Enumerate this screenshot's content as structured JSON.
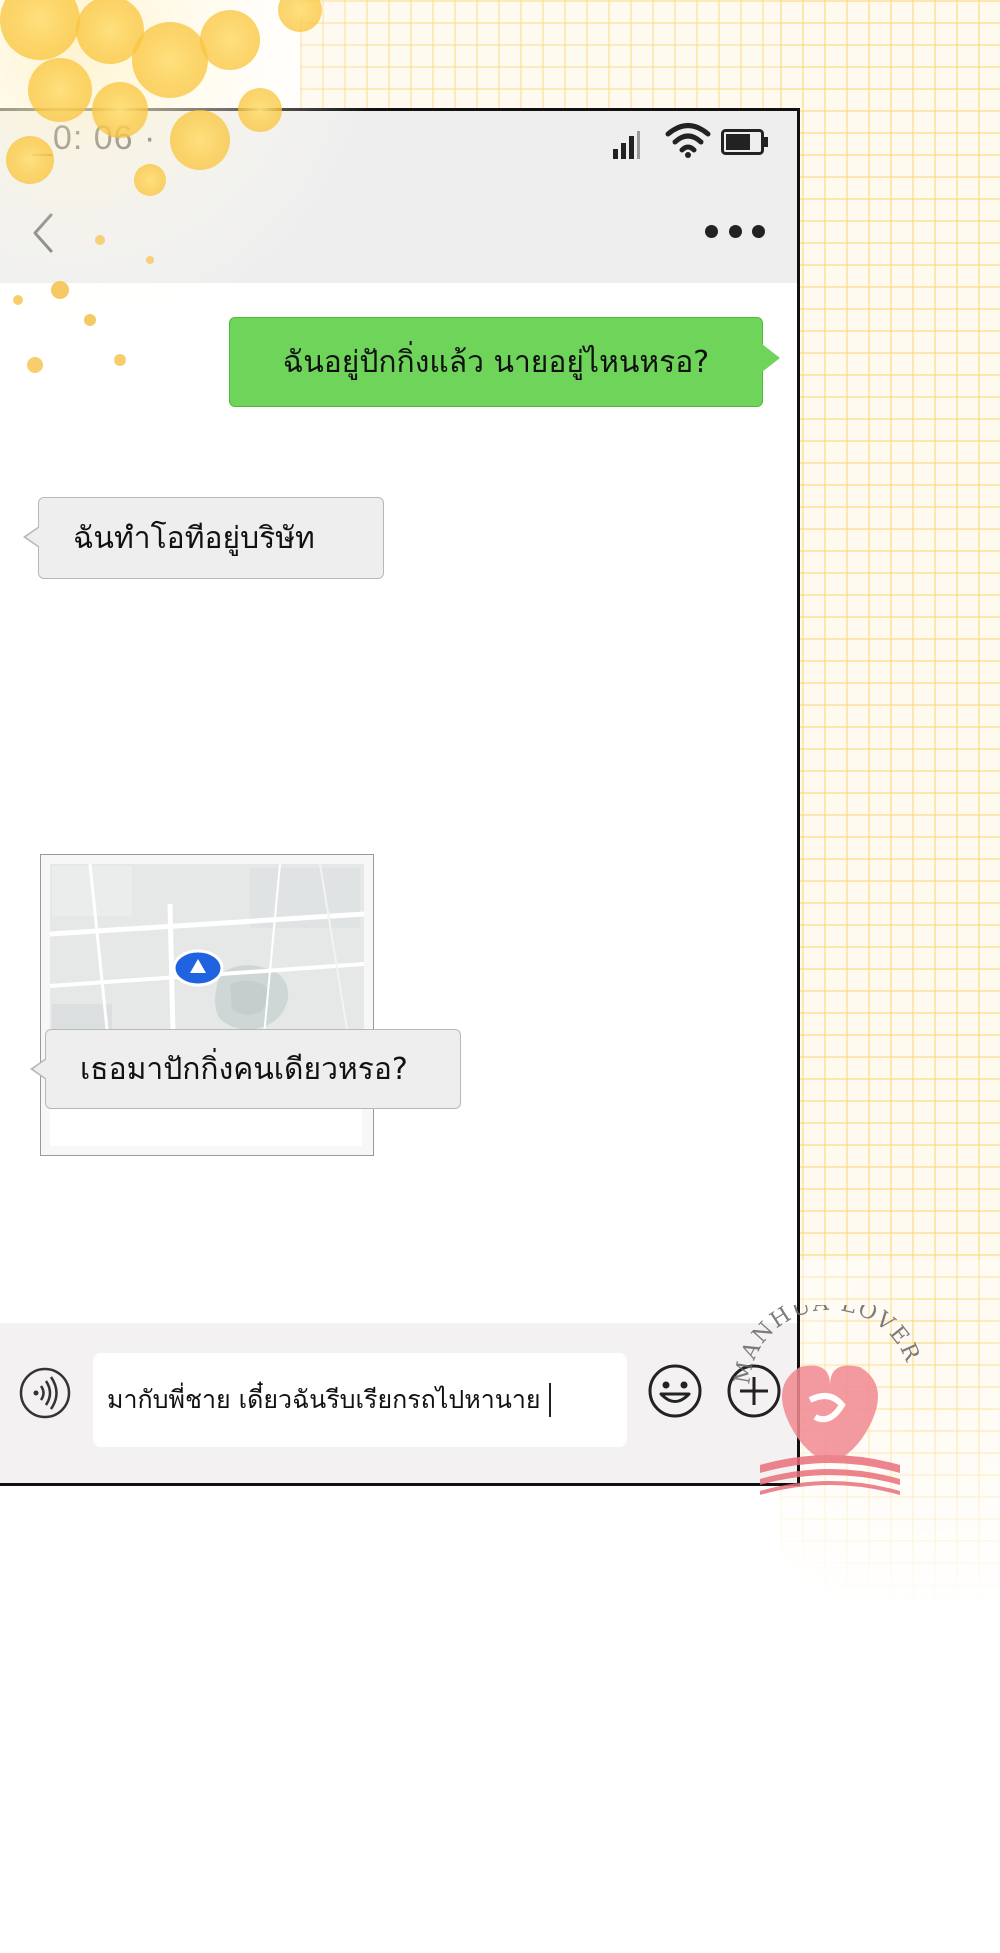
{
  "status_bar": {
    "time": "_0: 06 ·"
  },
  "messages": [
    {
      "side": "out",
      "text": "ฉันอยู่ปักกิ่งแล้ว นายอยู่ไหนหรอ?"
    },
    {
      "side": "in",
      "text": "ฉันทำโอทีอยู่บริษัท"
    },
    {
      "side": "in",
      "type": "location"
    },
    {
      "side": "in",
      "text": "เธอมาปักกิ่งคนเดียวหรอ?"
    }
  ],
  "input": {
    "value": "มากับพี่ชาย เดี๋ยวฉันรีบเรียกรถไปหานาย"
  },
  "icons": {
    "back": "chevron-left-icon",
    "more": "more-dots-icon",
    "voice": "voice-icon",
    "emoji": "emoji-icon",
    "plus": "plus-icon",
    "map_pin": "location-pin-icon"
  },
  "colors": {
    "outgoing_bubble": "#6fd55a",
    "incoming_bubble": "#eeeeee",
    "bar_background": "#eeeeee",
    "pin": "#1f63e0"
  },
  "watermark": {
    "text": "MANHUA LOVER"
  }
}
